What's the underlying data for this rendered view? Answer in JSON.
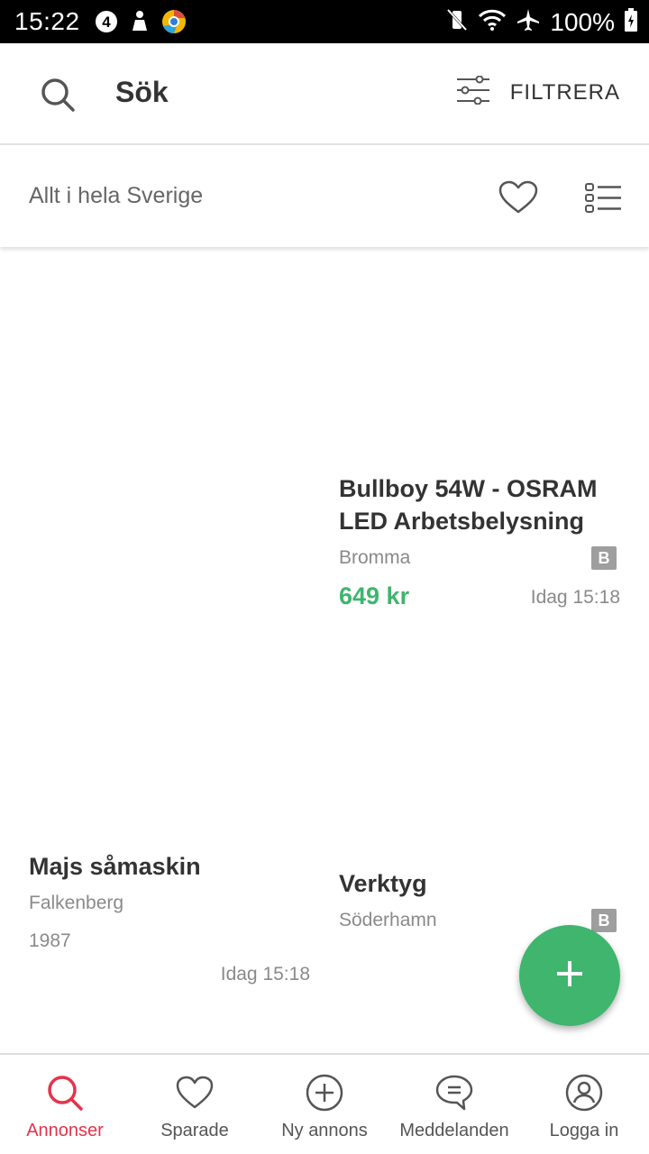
{
  "status_bar": {
    "time": "15:22",
    "battery": "100%",
    "left_icons": [
      "channel4-icon",
      "person-icon",
      "chrome-icon"
    ],
    "right_icons": [
      "mute-icon",
      "wifi-icon",
      "airplane-icon",
      "battery-icon"
    ]
  },
  "header": {
    "title": "Sök",
    "filter_label": "FILTRERA"
  },
  "location_bar": {
    "location": "Allt i hela Sverige"
  },
  "listings": [
    {
      "title_line1": "Bullboy 54W - OSRAM",
      "title_line2": "LED Arbetsbelysning",
      "location": "Bromma",
      "badge": "B",
      "price": "649 kr",
      "time": "Idag 15:18"
    },
    {
      "title": "Majs såmaskin",
      "location": "Falkenberg",
      "year": "1987",
      "time": "Idag 15:18"
    },
    {
      "title": "Verktyg",
      "location": "Söderhamn",
      "badge": "B"
    }
  ],
  "bottom_nav": {
    "items": [
      {
        "label": "Annonser",
        "icon": "search-icon"
      },
      {
        "label": "Sparade",
        "icon": "heart-icon"
      },
      {
        "label": "Ny annons",
        "icon": "plus-circle-icon"
      },
      {
        "label": "Meddelanden",
        "icon": "chat-icon"
      },
      {
        "label": "Logga in",
        "icon": "user-icon"
      }
    ],
    "active": "Annonser"
  },
  "colors": {
    "accent_green": "#3fb56e",
    "active_red": "#e5334b"
  }
}
